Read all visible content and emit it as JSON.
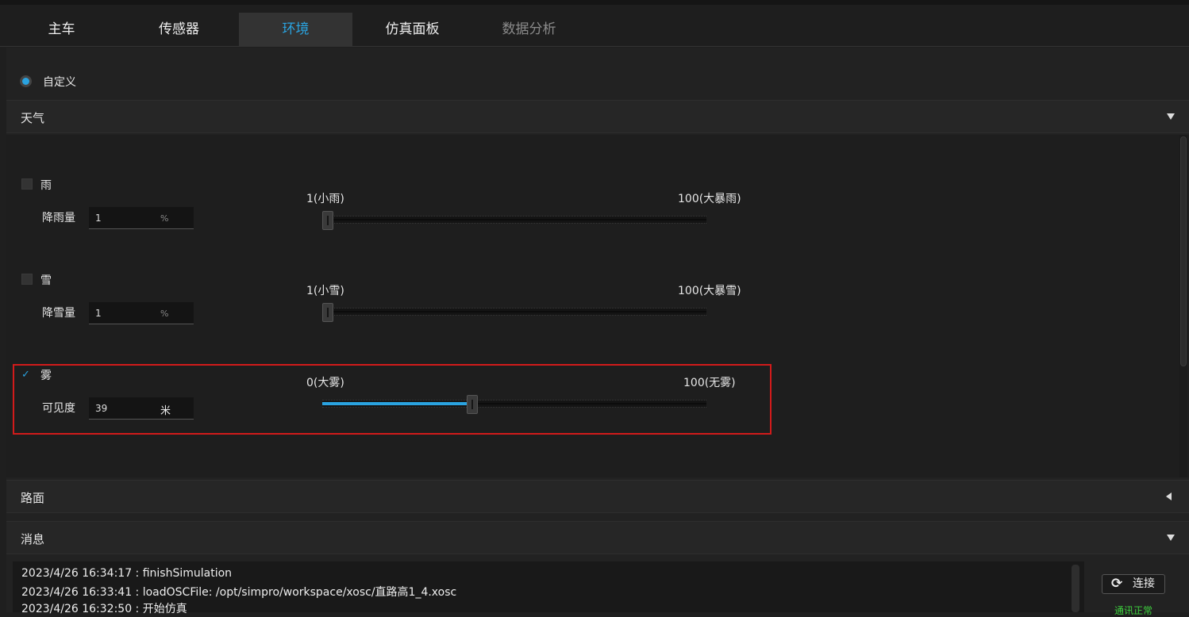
{
  "tabs": [
    {
      "label": "主车",
      "state": "normal"
    },
    {
      "label": "传感器",
      "state": "normal"
    },
    {
      "label": "环境",
      "state": "active"
    },
    {
      "label": "仿真面板",
      "state": "normal"
    },
    {
      "label": "数据分析",
      "state": "disabled"
    }
  ],
  "mode": {
    "label": "自定义",
    "selected": true
  },
  "weather": {
    "title": "天气",
    "caret_icon": "caret-down-icon",
    "rain": {
      "label": "雨",
      "checked": false,
      "field_label": "降雨量",
      "value": "1",
      "unit": "%",
      "min_label": "1(小雨)",
      "max_label": "100(大暴雨)",
      "level": 1
    },
    "snow": {
      "label": "雪",
      "checked": false,
      "field_label": "降雪量",
      "value": "1",
      "unit": "%",
      "min_label": "1(小雪)",
      "max_label": "100(大暴雪)",
      "level": 1
    },
    "fog": {
      "label": "雾",
      "checked": true,
      "check_glyph": "✓",
      "field_label": "可见度",
      "value": "39",
      "unit": "米",
      "min_label": "0(大雾)",
      "max_label": "100(无雾)",
      "level": 39
    }
  },
  "road": {
    "title": "路面",
    "caret_icon": "caret-left-icon"
  },
  "messages": {
    "title": "消息",
    "caret_icon": "caret-down-icon",
    "lines": [
      "2023/4/26 16:34:17 : finishSimulation",
      "2023/4/26 16:33:41 : loadOSCFile: /opt/simpro/workspace/xosc/直路高1_4.xosc",
      "2023/4/26 16:32:50 : 开始仿真"
    ],
    "connect_icon": "refresh-icon",
    "connect_glyph": "⟳",
    "connect_label": "连接",
    "status": "通讯正常",
    "status_color": "#3dcf3d"
  },
  "colors": {
    "accent": "#2aa3e0",
    "highlight": "#d21b1b"
  }
}
